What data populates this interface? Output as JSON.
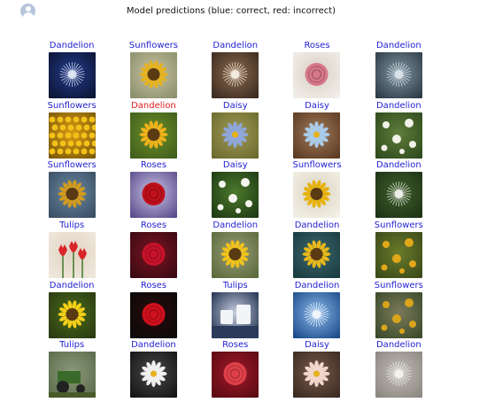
{
  "header": {
    "title": "Model predictions (blue: correct, red: incorrect)",
    "avatar_icon": "user-avatar-icon"
  },
  "colors": {
    "correct": "#1f1fd2",
    "incorrect": "#e31a1c"
  },
  "predictions": [
    {
      "label": "Dandelion",
      "correct": true,
      "bg": [
        "#0b1433",
        "#243c8a"
      ],
      "fg": "#dfe6f5",
      "shape": "puff"
    },
    {
      "label": "Sunflowers",
      "correct": true,
      "bg": [
        "#8a8f6a",
        "#c9c3a6"
      ],
      "fg": "#e8b21b",
      "shape": "sun"
    },
    {
      "label": "Dandelion",
      "correct": true,
      "bg": [
        "#3a2a1f",
        "#8c6a4e"
      ],
      "fg": "#f3ede0",
      "shape": "puff"
    },
    {
      "label": "Roses",
      "correct": true,
      "bg": [
        "#f2efe9",
        "#d8cfc4"
      ],
      "fg": "#d7778a",
      "shape": "rose"
    },
    {
      "label": "Dandelion",
      "correct": true,
      "bg": [
        "#2c3a44",
        "#7f95a2"
      ],
      "fg": "#d9e2e8",
      "shape": "puff"
    },
    {
      "label": "Sunflowers",
      "correct": true,
      "bg": [
        "#7a5a08",
        "#d99a12"
      ],
      "fg": "#f3c21a",
      "shape": "field"
    },
    {
      "label": "Dandelion",
      "correct": false,
      "bg": [
        "#3f5e1b",
        "#6f8f2a"
      ],
      "fg": "#f0b21a",
      "shape": "sun"
    },
    {
      "label": "Daisy",
      "correct": true,
      "bg": [
        "#6b6a2e",
        "#a09a55"
      ],
      "fg": "#8fa6d8",
      "shape": "daisy"
    },
    {
      "label": "Daisy",
      "correct": true,
      "bg": [
        "#5a3a22",
        "#a27a5a"
      ],
      "fg": "#a9cbe8",
      "shape": "daisy"
    },
    {
      "label": "Dandelion",
      "correct": true,
      "bg": [
        "#2f4a1e",
        "#5e7d3a"
      ],
      "fg": "#f2f2ea",
      "shape": "dots"
    },
    {
      "label": "Sunflowers",
      "correct": true,
      "bg": [
        "#3a4e63",
        "#6b8aa2"
      ],
      "fg": "#d39a1c",
      "shape": "sun"
    },
    {
      "label": "Roses",
      "correct": true,
      "bg": [
        "#5a4a8a",
        "#c8c4e6"
      ],
      "fg": "#c0101c",
      "shape": "rose"
    },
    {
      "label": "Daisy",
      "correct": true,
      "bg": [
        "#1e3a14",
        "#4c7a2c"
      ],
      "fg": "#f6f6f0",
      "shape": "dots"
    },
    {
      "label": "Sunflowers",
      "correct": true,
      "bg": [
        "#f3f0e6",
        "#d8d3c2"
      ],
      "fg": "#e7b10a",
      "shape": "sun"
    },
    {
      "label": "Dandelion",
      "correct": true,
      "bg": [
        "#1e3316",
        "#3e5e2a"
      ],
      "fg": "#eef0ec",
      "shape": "puff"
    },
    {
      "label": "Tulips",
      "correct": true,
      "bg": [
        "#f0e8dc",
        "#e0d2c2"
      ],
      "fg": "#d9242a",
      "shape": "tulip"
    },
    {
      "label": "Roses",
      "correct": true,
      "bg": [
        "#3a0a12",
        "#7a1422"
      ],
      "fg": "#c8122a",
      "shape": "rose"
    },
    {
      "label": "Dandelion",
      "correct": true,
      "bg": [
        "#5a6a3a",
        "#9a9c7a"
      ],
      "fg": "#f1c21a",
      "shape": "sun"
    },
    {
      "label": "Dandelion",
      "correct": true,
      "bg": [
        "#1a3a3f",
        "#3a6a6f"
      ],
      "fg": "#e8b81a",
      "shape": "sun"
    },
    {
      "label": "Sunflowers",
      "correct": true,
      "bg": [
        "#3a4a1a",
        "#6a7a2a"
      ],
      "fg": "#e2a81a",
      "shape": "dots"
    },
    {
      "label": "Dandelion",
      "correct": true,
      "bg": [
        "#2a3a12",
        "#4a6a1a"
      ],
      "fg": "#f5cf17",
      "shape": "sun"
    },
    {
      "label": "Roses",
      "correct": true,
      "bg": [
        "#0a0a0a",
        "#2a0a0a"
      ],
      "fg": "#d0101c",
      "shape": "rose"
    },
    {
      "label": "Tulips",
      "correct": true,
      "bg": [
        "#1a2a4a",
        "#c8cfe0"
      ],
      "fg": "#f2f4f8",
      "shape": "cups"
    },
    {
      "label": "Dandelion",
      "correct": true,
      "bg": [
        "#1a4a8a",
        "#8ab8e8"
      ],
      "fg": "#f2f6fb",
      "shape": "puff"
    },
    {
      "label": "Sunflowers",
      "correct": true,
      "bg": [
        "#3a4a2a",
        "#7a7a5a"
      ],
      "fg": "#d8a41a",
      "shape": "dots"
    },
    {
      "label": "Tulips",
      "correct": true,
      "bg": [
        "#5a6a4a",
        "#8a9a7a"
      ],
      "fg": "#3a6a2a",
      "shape": "tractor"
    },
    {
      "label": "Dandelion",
      "correct": true,
      "bg": [
        "#141414",
        "#4a4a4a"
      ],
      "fg": "#f0f0f0",
      "shape": "daisy"
    },
    {
      "label": "Roses",
      "correct": true,
      "bg": [
        "#5a0a12",
        "#a01a2a"
      ],
      "fg": "#e0404a",
      "shape": "rose"
    },
    {
      "label": "Daisy",
      "correct": true,
      "bg": [
        "#3a2a22",
        "#7a5a4a"
      ],
      "fg": "#f1d6cc",
      "shape": "daisy"
    },
    {
      "label": "Dandelion",
      "correct": true,
      "bg": [
        "#8a8680",
        "#c2beb6"
      ],
      "fg": "#f4f2ee",
      "shape": "puff"
    }
  ]
}
